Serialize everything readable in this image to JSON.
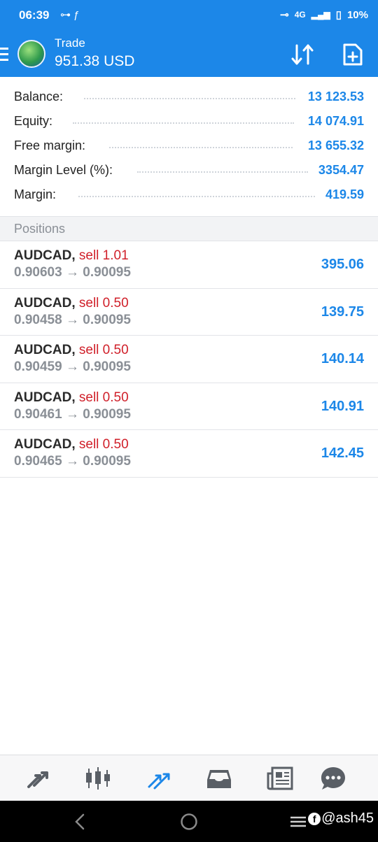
{
  "status_bar": {
    "time": "06:39",
    "network": "4G",
    "battery": "10%"
  },
  "header": {
    "title": "Trade",
    "value": "951.38 USD"
  },
  "summary": [
    {
      "label": "Balance:",
      "value": "13 123.53"
    },
    {
      "label": "Equity:",
      "value": "14 074.91"
    },
    {
      "label": "Free margin:",
      "value": "13 655.32"
    },
    {
      "label": "Margin Level (%):",
      "value": "3354.47"
    },
    {
      "label": "Margin:",
      "value": "419.59"
    }
  ],
  "positions_section": "Positions",
  "positions": [
    {
      "symbol": "AUDCAD,",
      "side": "sell 1.01",
      "open": "0.90603",
      "arrow": "→",
      "current": "0.90095",
      "profit": "395.06"
    },
    {
      "symbol": "AUDCAD,",
      "side": "sell 0.50",
      "open": "0.90458",
      "arrow": "→",
      "current": "0.90095",
      "profit": "139.75"
    },
    {
      "symbol": "AUDCAD,",
      "side": "sell 0.50",
      "open": "0.90459",
      "arrow": "→",
      "current": "0.90095",
      "profit": "140.14"
    },
    {
      "symbol": "AUDCAD,",
      "side": "sell 0.50",
      "open": "0.90461",
      "arrow": "→",
      "current": "0.90095",
      "profit": "140.91"
    },
    {
      "symbol": "AUDCAD,",
      "side": "sell 0.50",
      "open": "0.90465",
      "arrow": "→",
      "current": "0.90095",
      "profit": "142.45"
    }
  ],
  "watermark": "@ash45",
  "colors": {
    "accent": "#1c87e8",
    "sell": "#d0202a",
    "muted": "#8a8f96"
  }
}
